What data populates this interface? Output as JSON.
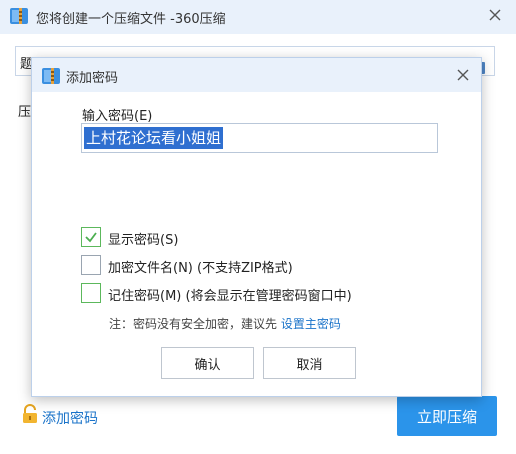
{
  "main_window": {
    "title": "您将创建一个压缩文件 -360压缩",
    "path_text": "题",
    "left_label": "压",
    "add_password_link": "添加密码",
    "compress_button": "立即压缩"
  },
  "dialog": {
    "title": "添加密码",
    "password_label": "输入密码(E)",
    "password_value": "上村花论坛看小姐姐",
    "options": [
      {
        "label": "显示密码(S)",
        "checked": true
      },
      {
        "label": "加密文件名(N) (不支持ZIP格式)",
        "checked": false
      },
      {
        "label": "记住密码(M) (将会显示在管理密码窗口中)",
        "checked": false
      }
    ],
    "note_prefix": "注：密码没有安全加密，建议先 ",
    "note_link": "设置主密码",
    "ok_button": "确认",
    "cancel_button": "取消"
  },
  "colors": {
    "accent": "#2b94ea",
    "link": "#1a73c9",
    "titlebar": "#e9f1fb",
    "check": "#5cb85c"
  }
}
